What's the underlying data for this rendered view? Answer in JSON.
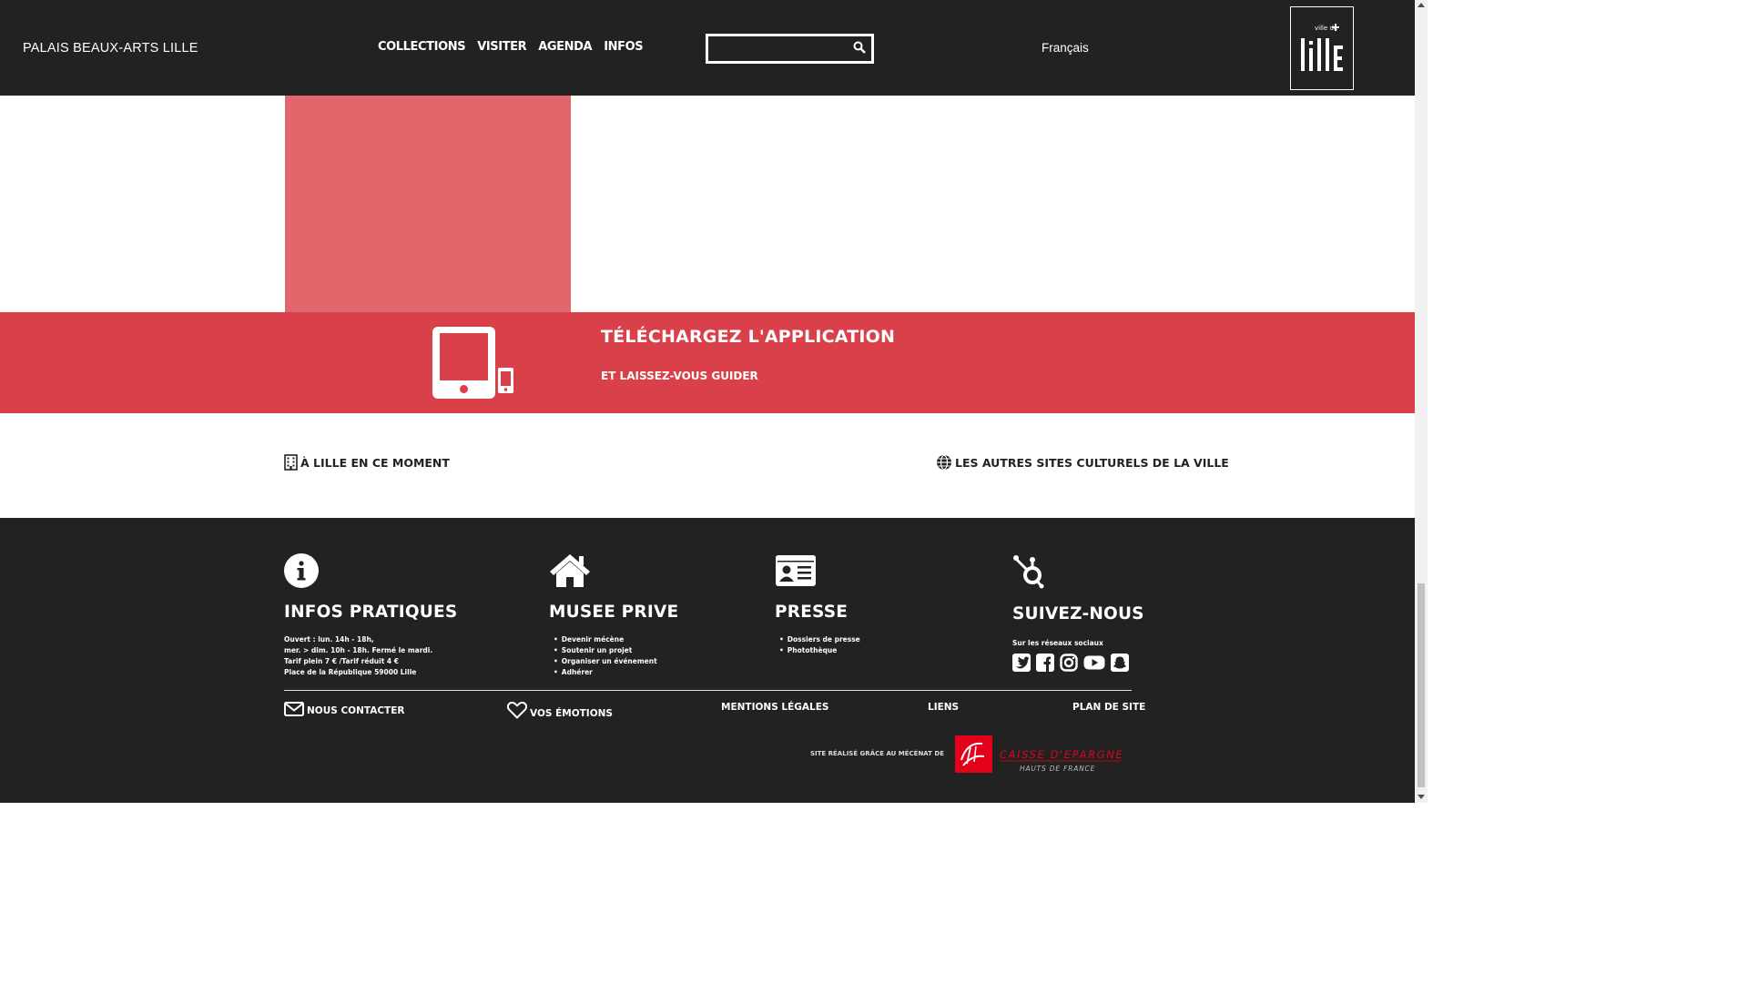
{
  "header": {
    "site_title": "PALAIS BEAUX-ARTS LILLE",
    "nav": [
      "COLLECTIONS",
      "VISITER",
      "AGENDA",
      "INFOS"
    ],
    "search": {
      "value": "",
      "placeholder": ""
    },
    "language": "Français",
    "logo": {
      "small_text": "ville de",
      "big_text": "lille"
    }
  },
  "app_banner": {
    "title": "TÉLÉCHARGEZ L'APPLICATION",
    "subtitle": "ET LAISSEZ-VOUS GUIDER"
  },
  "links": {
    "left": "À LILLE EN CE MOMENT",
    "right": "LES AUTRES SITES CULTURELS DE LA VILLE"
  },
  "footer": {
    "infos": {
      "title": "INFOS PRATIQUES",
      "lines": [
        "Ouvert : lun. 14h - 18h,",
        "mer. > dim. 10h - 18h. Fermé le mardi.",
        "Tarif plein 7 € /Tarif réduit 4 €",
        "Place de la République 59000 Lille"
      ]
    },
    "musee_prive": {
      "title": "MUSEE PRIVE",
      "items": [
        "Devenir mécène",
        "Soutenir un projet",
        "Organiser un événement",
        "Adhérer"
      ]
    },
    "presse": {
      "title": "PRESSE",
      "items": [
        "Dossiers de presse",
        "Photothèque"
      ]
    },
    "suivez": {
      "title": "SUIVEZ-NOUS",
      "subtitle": "Sur les réseaux sociaux",
      "networks": [
        "twitter-icon",
        "facebook-icon",
        "instagram-icon",
        "youtube-icon",
        "snapchat-icon"
      ]
    },
    "bottom": {
      "contact": "NOUS CONTACTER",
      "emotions": "VOS ÉMOTIONS",
      "mentions": "MENTIONS LÉGALES",
      "liens": "LIENS",
      "plan": "PLAN DE SITE"
    },
    "mecenat": "SITE RÉALISÉ GRÂCE AU MÉCÉNAT DE",
    "sponsor": {
      "name": "CAISSE D'EPARGNE",
      "region": "HAUTS DE FRANCE"
    }
  },
  "colors": {
    "dark": "#222222",
    "red": "#d94049",
    "pink": "#e2676c",
    "sponsor_red": "#e2001a"
  }
}
